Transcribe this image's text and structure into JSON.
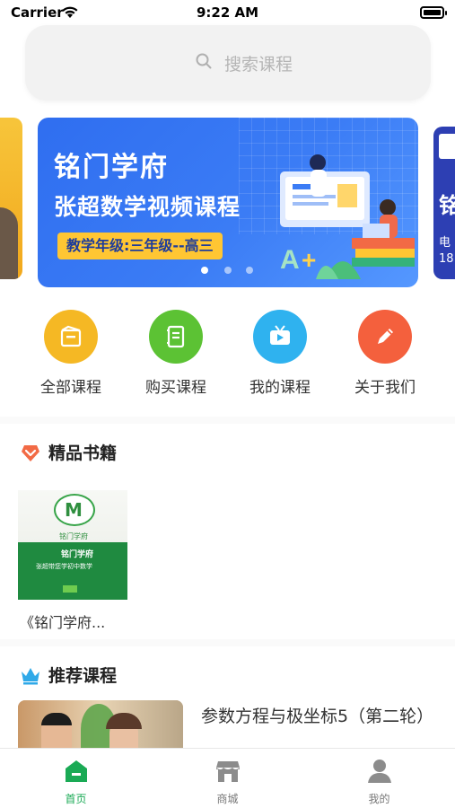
{
  "status_bar": {
    "carrier": "Carrier",
    "time": "9:22 AM"
  },
  "search": {
    "placeholder": "搜索课程"
  },
  "banner": {
    "title": "铭门学府",
    "subtitle": "张超数学视频课程",
    "tag": "教学年级:三年级--高三",
    "page_count": 3,
    "active_index": 0,
    "next_peek_char": "铭",
    "next_peek_line1": "电",
    "next_peek_line2": "18"
  },
  "nav": {
    "items": [
      {
        "label": "全部课程",
        "icon": "all-courses-icon",
        "color": "#f5b824"
      },
      {
        "label": "购买课程",
        "icon": "buy-courses-icon",
        "color": "#5cc234"
      },
      {
        "label": "我的课程",
        "icon": "my-courses-icon",
        "color": "#2fb2ef"
      },
      {
        "label": "关于我们",
        "icon": "about-us-icon",
        "color": "#f4603d"
      }
    ]
  },
  "books_section": {
    "title": "精品书籍",
    "icon_color": "#f26a45",
    "items": [
      {
        "title": "《铭门学府...",
        "cover_brand": "铭门学府",
        "cover_logo": "M",
        "cover_logo_text": "铭门学府",
        "cover_line": "张超带您学初中数学"
      }
    ]
  },
  "courses_section": {
    "title": "推荐课程",
    "icon_color": "#2fa9e8",
    "items": [
      {
        "title": "参数方程与极坐标5（第二轮）"
      }
    ]
  },
  "tab_bar": {
    "active_color": "#1aaa55",
    "items": [
      {
        "label": "首页",
        "icon": "home-icon",
        "active": true
      },
      {
        "label": "商城",
        "icon": "store-icon",
        "active": false
      },
      {
        "label": "我的",
        "icon": "profile-icon",
        "active": false
      }
    ]
  }
}
